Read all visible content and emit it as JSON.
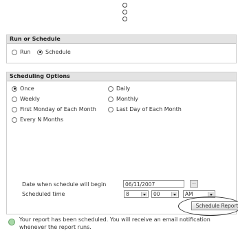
{
  "run_or_schedule": {
    "title": "Run or Schedule",
    "options": [
      {
        "label": "Run",
        "selected": false
      },
      {
        "label": "Schedule",
        "selected": true
      }
    ]
  },
  "scheduling_options": {
    "title": "Scheduling Options",
    "options": [
      {
        "label": "Once",
        "selected": true
      },
      {
        "label": "Daily",
        "selected": false
      },
      {
        "label": "Weekly",
        "selected": false
      },
      {
        "label": "Monthly",
        "selected": false
      },
      {
        "label": "First Monday of Each Month",
        "selected": false
      },
      {
        "label": "Last Day of Each Month",
        "selected": false
      },
      {
        "label": "Every N Months",
        "selected": false
      }
    ],
    "date_label": "Date when schedule will begin",
    "date_value": "06/11/2007",
    "time_label": "Scheduled time",
    "hour": "8",
    "minute": "00",
    "ampm": "AM",
    "schedule_button": "Schedule Report"
  },
  "notification": "Your report has been scheduled. You will receive an email notification whenever the report runs."
}
